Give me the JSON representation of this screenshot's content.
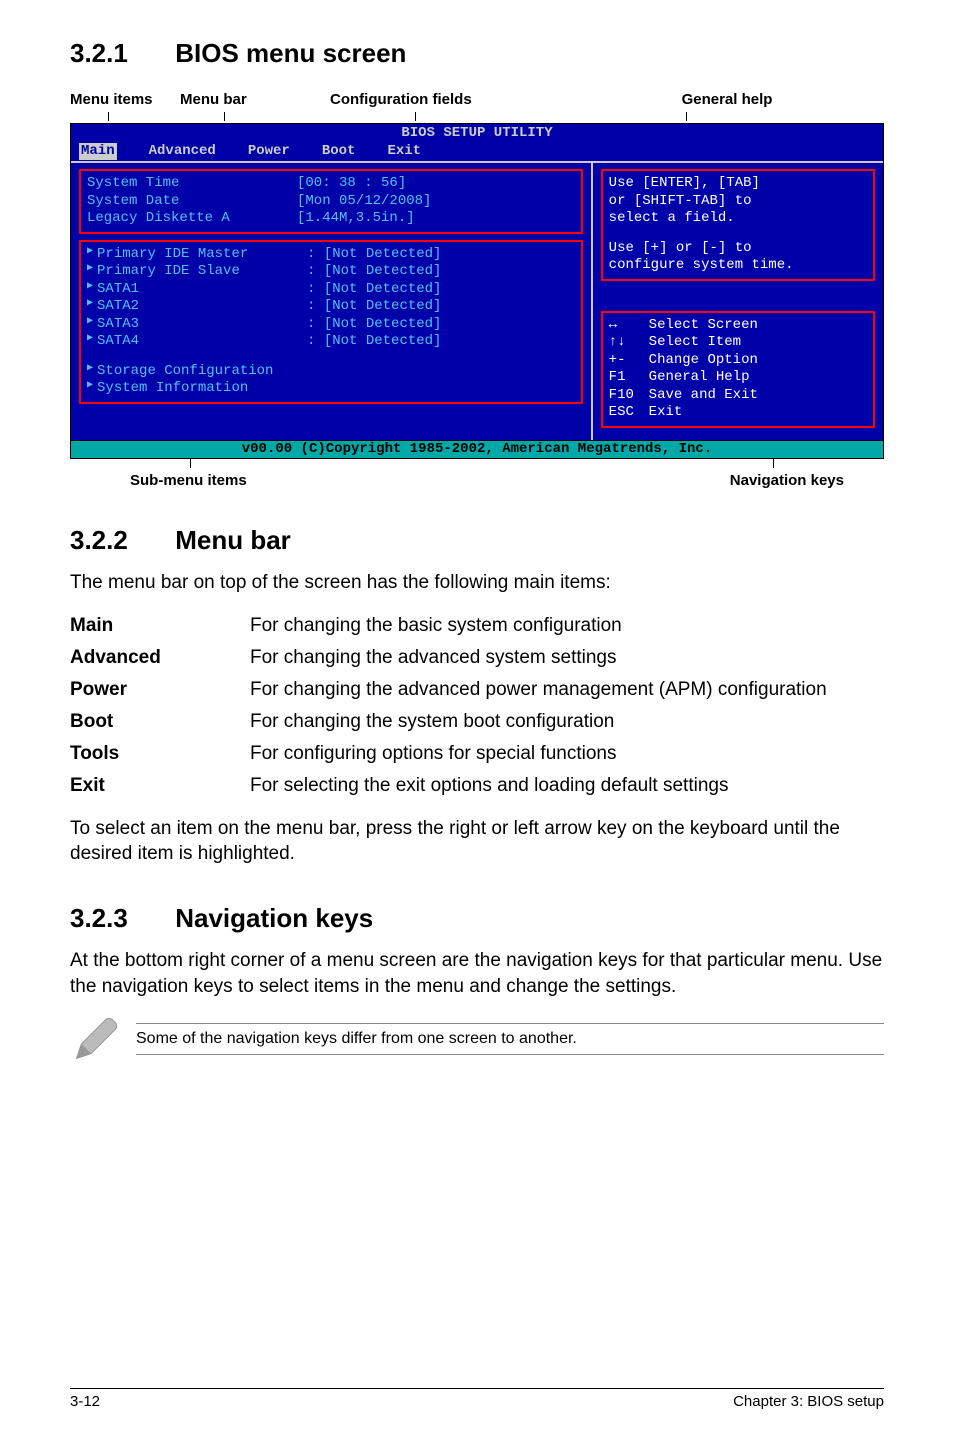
{
  "s1": {
    "num": "3.2.1",
    "title": "BIOS menu screen"
  },
  "labels": {
    "menu_items": "Menu items",
    "menu_bar": "Menu bar",
    "config_fields": "Configuration fields",
    "general_help": "General help",
    "sub_items": "Sub-menu items",
    "nav_keys": "Navigation keys"
  },
  "bios": {
    "title": "BIOS SETUP UTILITY",
    "tabs": [
      "Main",
      "Advanced",
      "Power",
      "Boot",
      "Exit"
    ],
    "rows1": [
      {
        "k": "System Time",
        "v": "[00: 38 : 56]"
      },
      {
        "k": "System Date",
        "v": "[Mon 05/12/2008]"
      },
      {
        "k": "Legacy Diskette A",
        "v": "[1.44M,3.5in.]"
      }
    ],
    "rows2": [
      {
        "k": "Primary IDE Master",
        "v": ": [Not Detected]",
        "tri": true
      },
      {
        "k": "Primary IDE Slave",
        "v": ": [Not Detected]",
        "tri": true
      },
      {
        "k": "SATA1",
        "v": ": [Not Detected]",
        "tri": true
      },
      {
        "k": "SATA2",
        "v": ": [Not Detected]",
        "tri": true
      },
      {
        "k": "SATA3",
        "v": ": [Not Detected]",
        "tri": true
      },
      {
        "k": "SATA4",
        "v": ": [Not Detected]",
        "tri": true
      }
    ],
    "rows3": [
      {
        "k": "Storage Configuration",
        "tri": true
      },
      {
        "k": "System Information",
        "tri": true
      }
    ],
    "help1a": "Use [ENTER], [TAB]",
    "help1b": "or [SHIFT-TAB] to",
    "help1c": "select a field.",
    "help2a": "Use [+] or [-] to",
    "help2b": "configure system time.",
    "keys": [
      {
        "k": "↔",
        "d": "Select Screen"
      },
      {
        "k": "↑↓",
        "d": "Select Item"
      },
      {
        "k": "+-",
        "d": "Change Option"
      },
      {
        "k": "F1",
        "d": "General Help"
      },
      {
        "k": "F10",
        "d": "Save and Exit"
      },
      {
        "k": "ESC",
        "d": "Exit"
      }
    ],
    "footer": "v00.00 (C)Copyright 1985-2002, American Megatrends, Inc."
  },
  "s2": {
    "num": "3.2.2",
    "title": "Menu bar"
  },
  "s2p": "The menu bar on top of the screen has the following main items:",
  "defs": [
    {
      "t": "Main",
      "d": "For changing the basic system configuration"
    },
    {
      "t": "Advanced",
      "d": "For changing the advanced system settings"
    },
    {
      "t": "Power",
      "d": "For changing the advanced power management (APM) configuration"
    },
    {
      "t": "Boot",
      "d": "For changing the system boot configuration"
    },
    {
      "t": "Tools",
      "d": "For configuring options for special functions"
    },
    {
      "t": "Exit",
      "d": "For selecting the exit options and loading default settings"
    }
  ],
  "s2p2": "To select an item on the menu bar, press the right or left arrow key on the keyboard until the desired item is highlighted.",
  "s3": {
    "num": "3.2.3",
    "title": "Navigation keys"
  },
  "s3p": "At the bottom right corner of a menu screen are the navigation keys for that particular menu. Use the navigation keys to select items in the menu and change the settings.",
  "note": "Some of the navigation keys differ from one screen to another.",
  "pf_left": "3-12",
  "pf_right": "Chapter 3: BIOS setup"
}
